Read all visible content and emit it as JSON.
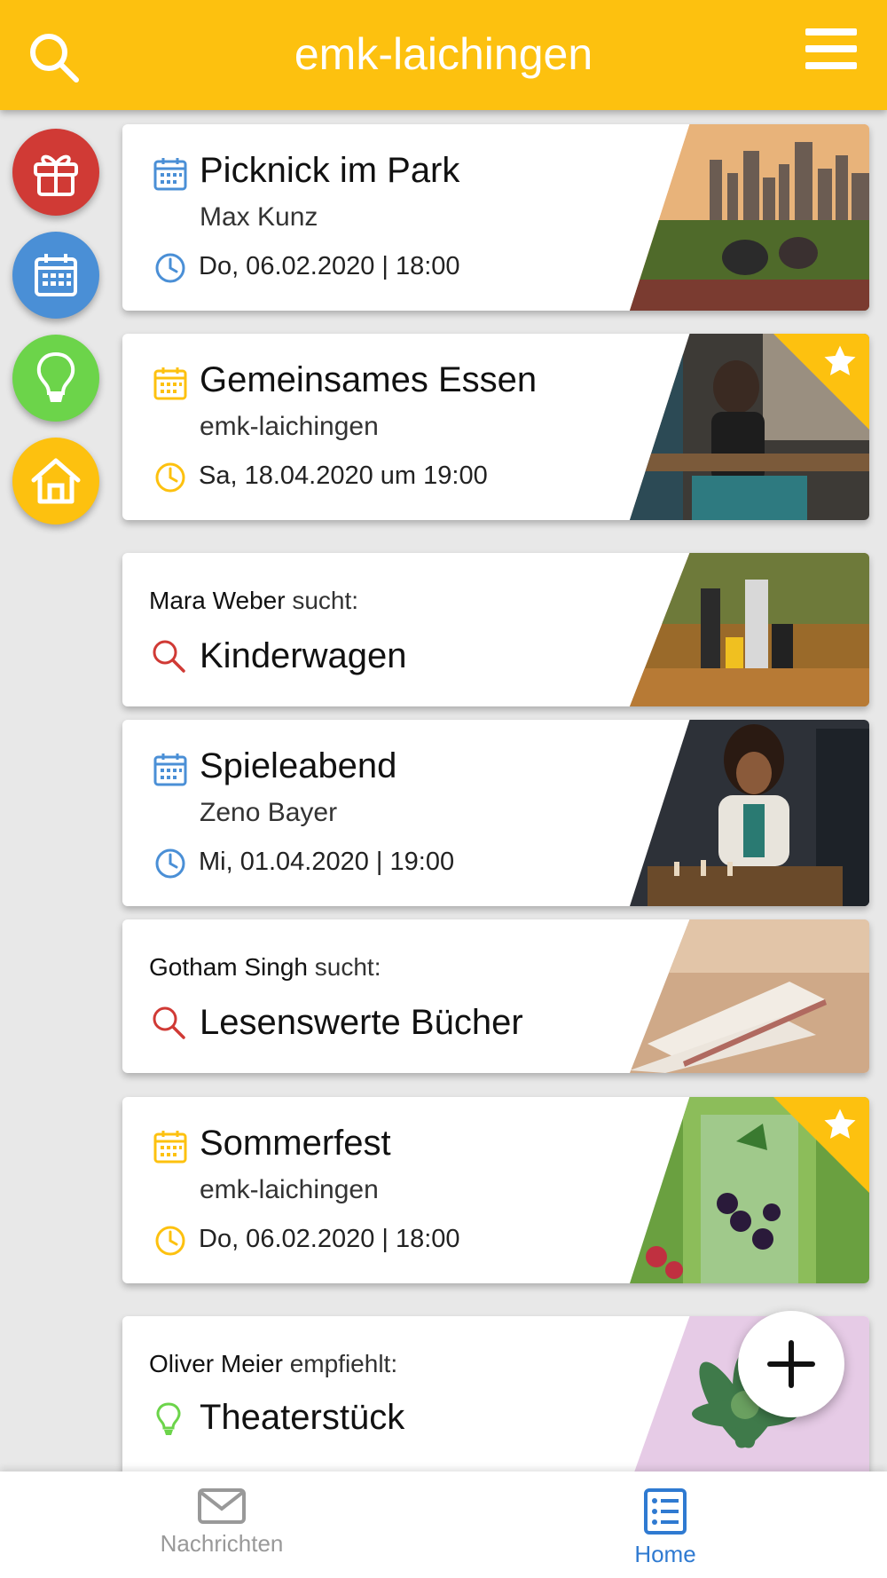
{
  "header": {
    "title": "emk-laichingen"
  },
  "filters": [
    "gift-icon",
    "calendar-icon",
    "lightbulb-icon",
    "home-icon"
  ],
  "colors": {
    "accent": "#fdc10f",
    "red": "#d03a35",
    "blue": "#4a8fd6",
    "green": "#6cd44a",
    "nav_active": "#2f7ad1"
  },
  "cards": [
    {
      "type": "event",
      "title": "Picknick im Park",
      "subtitle": "Max Kunz",
      "date": "Do, 06.02.2020 | 18:00",
      "color": "#4a8fd6",
      "featured": false
    },
    {
      "type": "event",
      "title": "Gemeinsames Essen",
      "subtitle": "emk-laichingen",
      "date": "Sa, 18.04.2020 um 19:00",
      "color": "#fdc10f",
      "featured": true
    },
    {
      "type": "search",
      "person": "Mara Weber",
      "verb": "sucht:",
      "title": "Kinderwagen",
      "color": "#d03a35"
    },
    {
      "type": "event",
      "title": "Spieleabend",
      "subtitle": "Zeno Bayer",
      "date": "Mi, 01.04.2020 | 19:00",
      "color": "#4a8fd6",
      "featured": false
    },
    {
      "type": "search",
      "person": "Gotham Singh",
      "verb": "sucht:",
      "title": "Lesenswerte Bücher",
      "color": "#d03a35"
    },
    {
      "type": "event",
      "title": "Sommerfest",
      "subtitle": "emk-laichingen",
      "date": "Do, 06.02.2020 | 18:00",
      "color": "#fdc10f",
      "featured": true
    },
    {
      "type": "recommend",
      "person": "Oliver Meier",
      "verb": "empfiehlt:",
      "title": "Theaterstück",
      "color": "#6cd44a"
    }
  ],
  "bottom_nav": [
    {
      "label": "Nachrichten",
      "icon": "mail-icon",
      "active": false
    },
    {
      "label": "Home",
      "icon": "list-icon",
      "active": true
    }
  ]
}
